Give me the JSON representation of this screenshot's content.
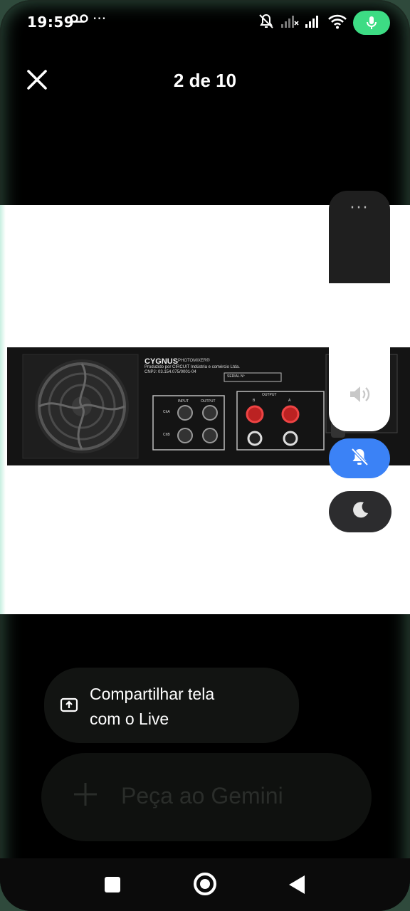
{
  "status_bar": {
    "time": "19:59",
    "more_indicator": "···",
    "icons": [
      "voicemail-icon",
      "notifications-off-icon",
      "signal-off-icon",
      "signal-icon",
      "wifi-icon",
      "mic-active-icon"
    ],
    "mic_color": "#3ddc84"
  },
  "viewer": {
    "counter": "2 de 10",
    "close_icon": "close-icon"
  },
  "photo": {
    "brand": "CYGNUS",
    "model": "PHOTOMIXER®",
    "maker_line": "Produzido por CIRCUIT Indústria e comércio Ltda.",
    "cnpj_line": "CNPJ: 03.154.075/0001-04",
    "serial_label": "SERIAL Nº",
    "input_label": "INPUT",
    "output_label": "OUTPUT",
    "cha_label": "ChA",
    "chb_label": "ChB",
    "speaker_output_label": "OUTPUT",
    "b_label": "B",
    "a_label": "A"
  },
  "volume_panel": {
    "more_label": "···",
    "volume_icon": "speaker-icon",
    "ring_mode_icon": "bell-off-icon",
    "dnd_icon": "moon-icon",
    "accent": "#3b82f6"
  },
  "share_card": {
    "label_line1": "Compartilhar tela",
    "label_line2": "com o Live",
    "icon": "screen-share-icon"
  },
  "composer": {
    "placeholder": "Peça ao Gemini",
    "plus_icon": "plus-icon"
  },
  "nav_bar": {
    "recent_icon": "square-icon",
    "home_icon": "circle-icon",
    "back_icon": "triangle-back-icon"
  }
}
